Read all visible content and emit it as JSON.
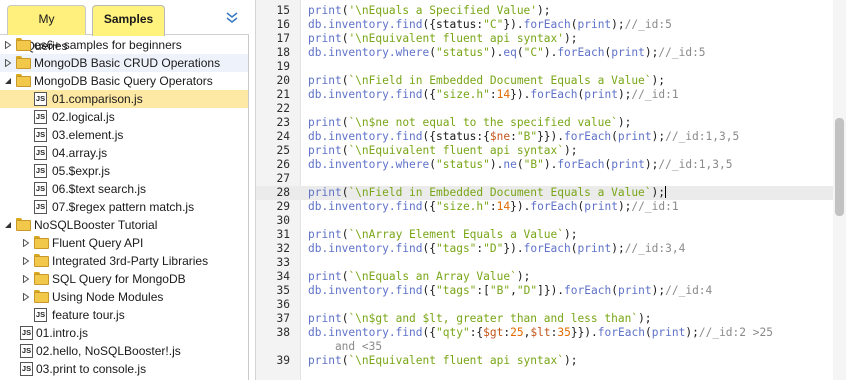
{
  "tabs": [
    {
      "label": "My Queries",
      "active": false
    },
    {
      "label": "Samples",
      "active": true
    }
  ],
  "tree": [
    {
      "id": "es6",
      "label": "es6+ samples for beginners",
      "kind": "folder",
      "depth": 0,
      "expanded": false,
      "selected": false
    },
    {
      "id": "crud",
      "label": "MongoDB Basic CRUD Operations",
      "kind": "folder",
      "depth": 0,
      "expanded": false,
      "selected": false,
      "faint": true
    },
    {
      "id": "query",
      "label": "MongoDB Basic Query Operators",
      "kind": "folder",
      "depth": 0,
      "expanded": true,
      "selected": false
    },
    {
      "id": "f1",
      "label": "01.comparison.js",
      "kind": "file",
      "depth": 1,
      "selected": true
    },
    {
      "id": "f2",
      "label": "02.logical.js",
      "kind": "file",
      "depth": 1,
      "selected": false
    },
    {
      "id": "f3",
      "label": "03.element.js",
      "kind": "file",
      "depth": 1,
      "selected": false
    },
    {
      "id": "f4",
      "label": "04.array.js",
      "kind": "file",
      "depth": 1,
      "selected": false
    },
    {
      "id": "f5",
      "label": "05.$expr.js",
      "kind": "file",
      "depth": 1,
      "selected": false
    },
    {
      "id": "f6",
      "label": "06.$text search.js",
      "kind": "file",
      "depth": 1,
      "selected": false
    },
    {
      "id": "f7",
      "label": "07.$regex pattern match.js",
      "kind": "file",
      "depth": 1,
      "selected": false
    },
    {
      "id": "tut",
      "label": "NoSQLBooster Tutorial",
      "kind": "folder",
      "depth": 0,
      "expanded": true,
      "selected": false
    },
    {
      "id": "fq",
      "label": "Fluent Query API",
      "kind": "folder",
      "depth": 1,
      "expanded": false,
      "selected": false
    },
    {
      "id": "i3",
      "label": "Integrated 3rd-Party Libraries",
      "kind": "folder",
      "depth": 1,
      "expanded": false,
      "selected": false
    },
    {
      "id": "sql",
      "label": "SQL Query for MongoDB",
      "kind": "folder",
      "depth": 1,
      "expanded": false,
      "selected": false
    },
    {
      "id": "node",
      "label": "Using Node Modules",
      "kind": "folder",
      "depth": 1,
      "expanded": false,
      "selected": false
    },
    {
      "id": "ft",
      "label": "feature tour.js",
      "kind": "file",
      "depth": 1,
      "selected": false
    },
    {
      "id": "t1",
      "label": "01.intro.js",
      "kind": "file",
      "depth": 0,
      "selected": false
    },
    {
      "id": "t2",
      "label": "02.hello, NoSQLBooster!.js",
      "kind": "file",
      "depth": 0,
      "selected": false
    },
    {
      "id": "t3",
      "label": "03.print to console.js",
      "kind": "file",
      "depth": 0,
      "selected": false
    }
  ],
  "editor": {
    "active_line": 28,
    "lines": [
      {
        "n": "15",
        "segs": [
          [
            "pl",
            "print"
          ],
          [
            "",
            "("
          ],
          [
            "str",
            "'\\nEquals a Specified Value'"
          ],
          [
            "",
            ");"
          ]
        ]
      },
      {
        "n": "16",
        "segs": [
          [
            "pl",
            "db.inventory.find"
          ],
          [
            "",
            "({status:"
          ],
          [
            "str",
            "\"C\""
          ],
          [
            "",
            "})."
          ],
          [
            "pl",
            "forEach"
          ],
          [
            "",
            "("
          ],
          [
            "pl",
            "print"
          ],
          [
            "",
            ");"
          ],
          [
            "cm",
            "//_id:5"
          ]
        ]
      },
      {
        "n": "17",
        "segs": [
          [
            "pl",
            "print"
          ],
          [
            "",
            "("
          ],
          [
            "str",
            "'\\nEquivalent fluent api syntax'"
          ],
          [
            "",
            ");"
          ]
        ]
      },
      {
        "n": "18",
        "segs": [
          [
            "pl",
            "db.inventory.where"
          ],
          [
            "",
            "("
          ],
          [
            "str",
            "\"status\""
          ],
          [
            "",
            ")."
          ],
          [
            "pl",
            "eq"
          ],
          [
            "",
            "("
          ],
          [
            "str",
            "\"C\""
          ],
          [
            "",
            ")."
          ],
          [
            "pl",
            "forEach"
          ],
          [
            "",
            "("
          ],
          [
            "pl",
            "print"
          ],
          [
            "",
            ");"
          ],
          [
            "cm",
            "//_id:5"
          ]
        ]
      },
      {
        "n": "19",
        "segs": []
      },
      {
        "n": "20",
        "segs": [
          [
            "pl",
            "print"
          ],
          [
            "",
            "("
          ],
          [
            "str",
            "`\\nField in Embedded Document Equals a Value`"
          ],
          [
            "",
            ");"
          ]
        ]
      },
      {
        "n": "21",
        "segs": [
          [
            "pl",
            "db.inventory.find"
          ],
          [
            "",
            "({"
          ],
          [
            "str",
            "\"size.h\""
          ],
          [
            "",
            ":"
          ],
          [
            "num",
            "14"
          ],
          [
            "",
            "})."
          ],
          [
            "pl",
            "forEach"
          ],
          [
            "",
            "("
          ],
          [
            "pl",
            "print"
          ],
          [
            "",
            ");"
          ],
          [
            "cm",
            "//_id:1"
          ]
        ]
      },
      {
        "n": "22",
        "segs": []
      },
      {
        "n": "23",
        "segs": [
          [
            "pl",
            "print"
          ],
          [
            "",
            "("
          ],
          [
            "str",
            "`\\n$ne not equal to the specified value`"
          ],
          [
            "",
            ");"
          ]
        ]
      },
      {
        "n": "24",
        "segs": [
          [
            "pl",
            "db.inventory.find"
          ],
          [
            "",
            "({status:{"
          ],
          [
            "key",
            "$ne"
          ],
          [
            "",
            ":"
          ],
          [
            "str",
            "\"B\""
          ],
          [
            "",
            "}})."
          ],
          [
            "pl",
            "forEach"
          ],
          [
            "",
            "("
          ],
          [
            "pl",
            "print"
          ],
          [
            "",
            ");"
          ],
          [
            "cm",
            "//_id:1,3,5"
          ]
        ]
      },
      {
        "n": "25",
        "segs": [
          [
            "pl",
            "print"
          ],
          [
            "",
            "("
          ],
          [
            "str",
            "`\\nEquivalent fluent api syntax`"
          ],
          [
            "",
            ");"
          ]
        ]
      },
      {
        "n": "26",
        "segs": [
          [
            "pl",
            "db.inventory.where"
          ],
          [
            "",
            "("
          ],
          [
            "str",
            "\"status\""
          ],
          [
            "",
            ")."
          ],
          [
            "pl",
            "ne"
          ],
          [
            "",
            "("
          ],
          [
            "str",
            "\"B\""
          ],
          [
            "",
            ")."
          ],
          [
            "pl",
            "forEach"
          ],
          [
            "",
            "("
          ],
          [
            "pl",
            "print"
          ],
          [
            "",
            ");"
          ],
          [
            "cm",
            "//_id:1,3,5"
          ]
        ]
      },
      {
        "n": "27",
        "segs": []
      },
      {
        "n": "28",
        "segs": [
          [
            "pl",
            "print"
          ],
          [
            "",
            "("
          ],
          [
            "str",
            "`\\nField in Embedded Document Equals a Value`"
          ],
          [
            "",
            ");"
          ]
        ],
        "cursor": true
      },
      {
        "n": "29",
        "segs": [
          [
            "pl",
            "db.inventory.find"
          ],
          [
            "",
            "({"
          ],
          [
            "str",
            "\"size.h\""
          ],
          [
            "",
            ":"
          ],
          [
            "num",
            "14"
          ],
          [
            "",
            "})."
          ],
          [
            "pl",
            "forEach"
          ],
          [
            "",
            "("
          ],
          [
            "pl",
            "print"
          ],
          [
            "",
            ");"
          ],
          [
            "cm",
            "//_id:1"
          ]
        ]
      },
      {
        "n": "30",
        "segs": []
      },
      {
        "n": "31",
        "segs": [
          [
            "pl",
            "print"
          ],
          [
            "",
            "("
          ],
          [
            "str",
            "`\\nArray Element Equals a Value`"
          ],
          [
            "",
            ");"
          ]
        ]
      },
      {
        "n": "32",
        "segs": [
          [
            "pl",
            "db.inventory.find"
          ],
          [
            "",
            "({"
          ],
          [
            "str",
            "\"tags\""
          ],
          [
            "",
            ":"
          ],
          [
            "str",
            "\"D\""
          ],
          [
            "",
            "})."
          ],
          [
            "pl",
            "forEach"
          ],
          [
            "",
            "("
          ],
          [
            "pl",
            "print"
          ],
          [
            "",
            ");"
          ],
          [
            "cm",
            "//_id:3,4"
          ]
        ]
      },
      {
        "n": "33",
        "segs": []
      },
      {
        "n": "34",
        "segs": [
          [
            "pl",
            "print"
          ],
          [
            "",
            "("
          ],
          [
            "str",
            "`\\nEquals an Array Value`"
          ],
          [
            "",
            ");"
          ]
        ]
      },
      {
        "n": "35",
        "segs": [
          [
            "pl",
            "db.inventory.find"
          ],
          [
            "",
            "({"
          ],
          [
            "str",
            "\"tags\""
          ],
          [
            "",
            ":["
          ],
          [
            "str",
            "\"B\""
          ],
          [
            "",
            ","
          ],
          [
            "str",
            "\"D\""
          ],
          [
            "",
            "]})."
          ],
          [
            "pl",
            "forEach"
          ],
          [
            "",
            "("
          ],
          [
            "pl",
            "print"
          ],
          [
            "",
            ");"
          ],
          [
            "cm",
            "//_id:4"
          ]
        ]
      },
      {
        "n": "36",
        "segs": []
      },
      {
        "n": "37",
        "segs": [
          [
            "pl",
            "print"
          ],
          [
            "",
            "("
          ],
          [
            "str",
            "`\\n$gt and $lt, greater than and less than`"
          ],
          [
            "",
            ");"
          ]
        ]
      },
      {
        "n": "38",
        "segs": [
          [
            "pl",
            "db.inventory.find"
          ],
          [
            "",
            "({"
          ],
          [
            "str",
            "\"qty\""
          ],
          [
            "",
            ":{"
          ],
          [
            "key",
            "$gt"
          ],
          [
            "",
            ":"
          ],
          [
            "num",
            "25"
          ],
          [
            "",
            ","
          ],
          [
            "key",
            "$lt"
          ],
          [
            "",
            ":"
          ],
          [
            "num",
            "35"
          ],
          [
            "",
            "}})."
          ],
          [
            "pl",
            "forEach"
          ],
          [
            "",
            "("
          ],
          [
            "pl",
            "print"
          ],
          [
            "",
            ");"
          ],
          [
            "cm",
            "//_id:2 >25"
          ]
        ]
      },
      {
        "n": "",
        "segs": [
          [
            "cm",
            "    and <35"
          ]
        ]
      },
      {
        "n": "39",
        "segs": [
          [
            "pl",
            "print"
          ],
          [
            "",
            "("
          ],
          [
            "str",
            "`\\nEquivalent fluent api syntax`"
          ],
          [
            "",
            ");"
          ]
        ]
      }
    ]
  }
}
